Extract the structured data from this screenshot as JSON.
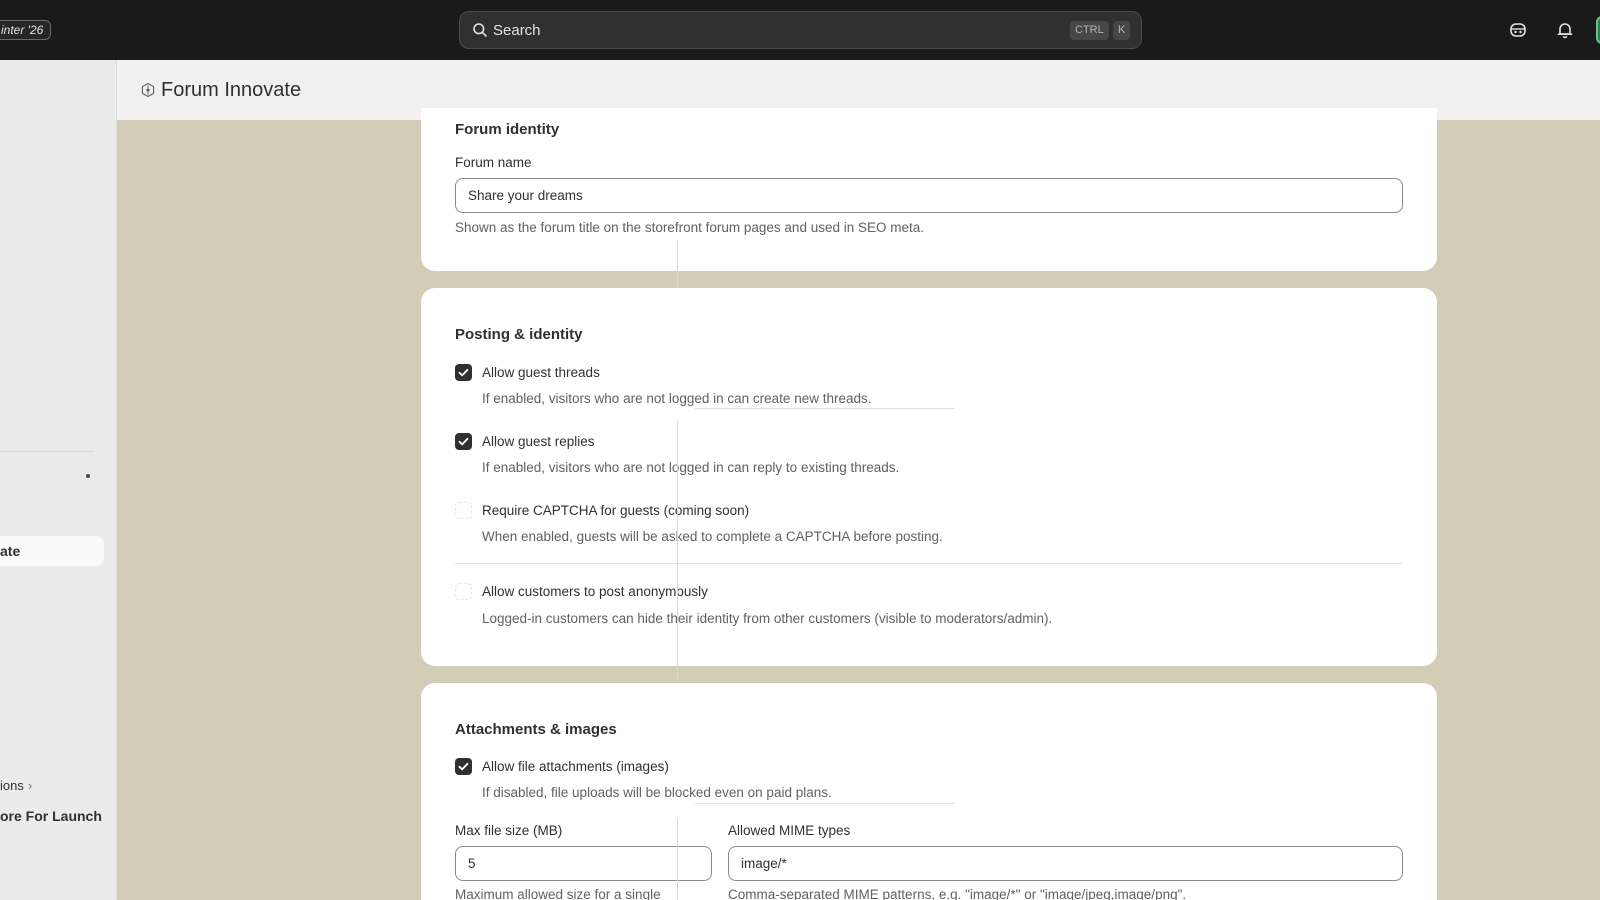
{
  "topbar": {
    "edition_badge": "inter '26",
    "search_placeholder": "Search",
    "shortcut_ctrl": "CTRL",
    "shortcut_key": "K",
    "icons": [
      "search-icon",
      "sidekick-icon",
      "bell-icon"
    ]
  },
  "sidebar": {
    "active_item": "ate",
    "item_ions": "ions",
    "item_launch": "ore For Launch"
  },
  "header": {
    "app_icon": "app-hexagon-icon",
    "title": "Forum Innovate"
  },
  "forum_identity": {
    "title": "Forum identity",
    "forum_name_label": "Forum name",
    "forum_name_value": "Share your dreams",
    "forum_name_help": "Shown as the forum title on the storefront forum pages and used in SEO meta."
  },
  "posting_identity": {
    "title": "Posting & identity",
    "options": [
      {
        "label": "Allow guest threads",
        "help": "If enabled, visitors who are not logged in can create new threads.",
        "checked": true
      },
      {
        "label": "Allow guest replies",
        "help": "If enabled, visitors who are not logged in can reply to existing threads.",
        "checked": true
      },
      {
        "label": "Require CAPTCHA for guests (coming soon)",
        "help": "When enabled, guests will be asked to complete a CAPTCHA before posting.",
        "checked": false
      },
      {
        "label": "Allow customers to post anonymously",
        "help": "Logged-in customers can hide their identity from other customers (visible to moderators/admin).",
        "checked": false
      }
    ]
  },
  "attachments": {
    "title": "Attachments & images",
    "allow_label": "Allow file attachments (images)",
    "allow_help": "If disabled, file uploads will be blocked even on paid plans.",
    "allow_checked": true,
    "max_size_label": "Max file size (MB)",
    "max_size_value": "5",
    "max_size_help": "Maximum allowed size for a single",
    "mime_label": "Allowed MIME types",
    "mime_value": "image/*",
    "mime_help": "Comma-separated MIME patterns, e.g. \"image/*\" or \"image/jpeg,image/png\"."
  }
}
